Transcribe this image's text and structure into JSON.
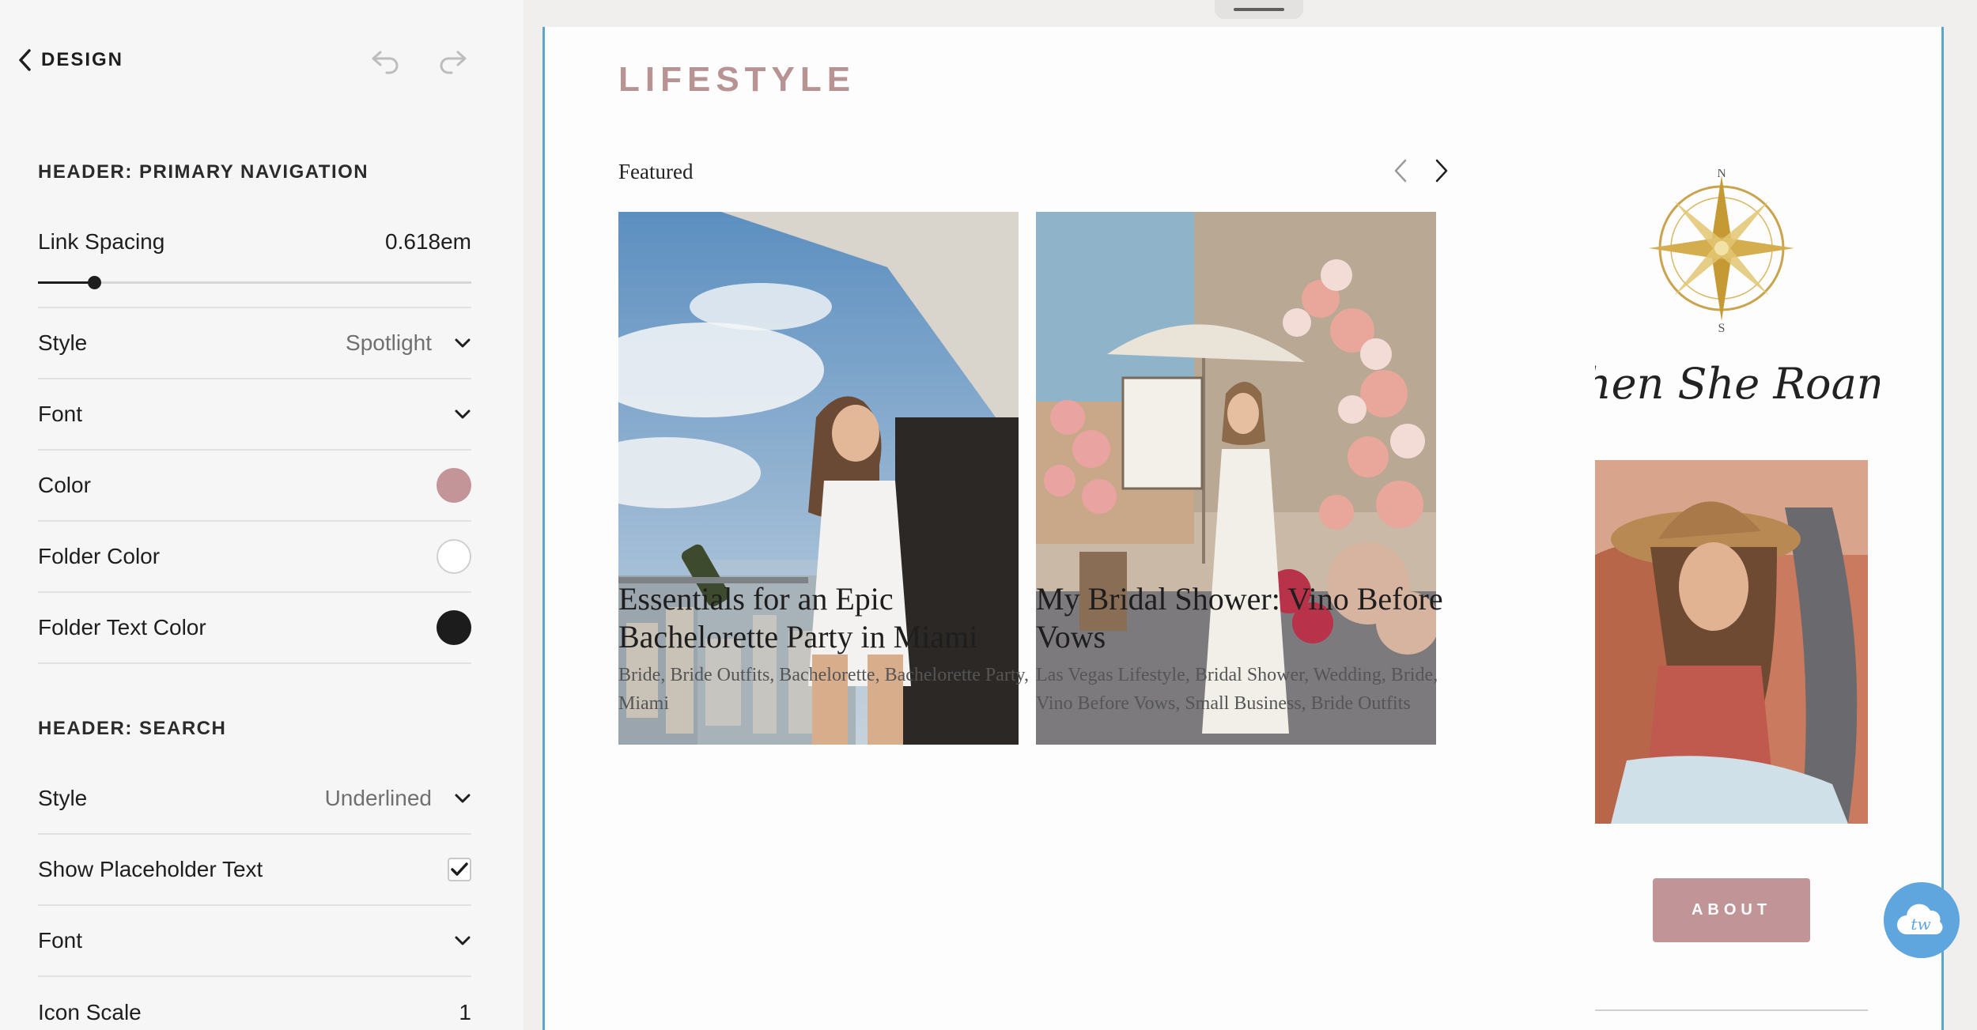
{
  "panel": {
    "back_label": "DESIGN",
    "sections": {
      "primary_nav": {
        "title": "HEADER: PRIMARY NAVIGATION",
        "link_spacing": {
          "label": "Link Spacing",
          "value": "0.618em",
          "slider_fraction": 0.13
        },
        "style": {
          "label": "Style",
          "value": "Spotlight"
        },
        "font": {
          "label": "Font"
        },
        "color": {
          "label": "Color",
          "swatch": "#c49598"
        },
        "folder_color": {
          "label": "Folder Color",
          "swatch": "#ffffff"
        },
        "folder_text_color": {
          "label": "Folder Text Color",
          "swatch": "#1c1c1c"
        }
      },
      "search": {
        "title": "HEADER: SEARCH",
        "style": {
          "label": "Style",
          "value": "Underlined"
        },
        "show_placeholder": {
          "label": "Show Placeholder Text",
          "checked": true
        },
        "font": {
          "label": "Font"
        },
        "icon_scale": {
          "label": "Icon Scale",
          "value": "1"
        }
      }
    }
  },
  "preview": {
    "page_title": "LIFESTYLE",
    "featured_label": "Featured",
    "posts": [
      {
        "title": "Essentials for an Epic Bachelorette Party in Miami",
        "tags": "Bride, Bride Outfits, Bachelorette, Bachelorette Party, Miami"
      },
      {
        "title": "My Bridal Shower: Vino Before Vows",
        "tags": "Las Vegas Lifestyle, Bridal Shower, Wedding, Bride, Vino Before Vows, Small Business, Bride Outfits"
      }
    ],
    "sidebar": {
      "logo_text": "When She Roams",
      "compass_letters": {
        "n": "N",
        "s": "S"
      },
      "about_label": "ABOUT"
    },
    "badge_text": "tw"
  },
  "colors": {
    "accent": "#b79394",
    "button": "#c19598",
    "frame_border": "#5aa6cc",
    "badge": "#5fa5de"
  }
}
